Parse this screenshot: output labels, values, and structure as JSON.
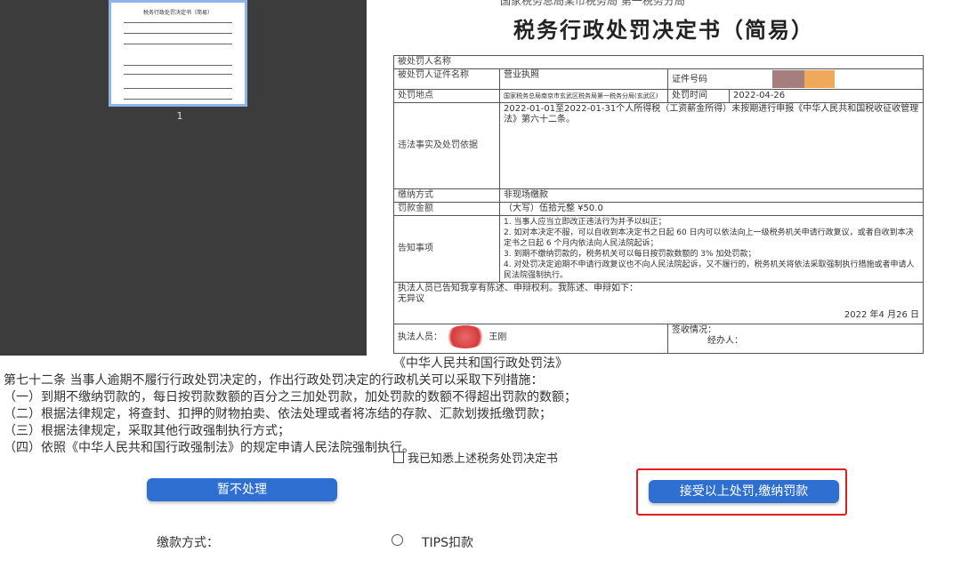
{
  "thumbnail": {
    "page_number": "1",
    "mini_title": "税务行政处罚决定书（简易）"
  },
  "document": {
    "top_text": "国家税务总局某市税务局  第一税务分局",
    "title": "税务行政处罚决定书（简易）",
    "rows": {
      "party_name_label": "被处罚人名称",
      "party_id_label": "被处罚人证件名称",
      "party_id_value": "营业执照",
      "cert_no_label": "证件号码",
      "location_label": "处罚地点",
      "location_value": "国家税务总局南京市玄武区税务局第一税务分局(玄武区)",
      "time_label": "处罚时间",
      "time_value": "2022-04-26",
      "facts_label": "违法事实及处罚依据",
      "facts_value": "2022-01-01至2022-01-31个人所得税（工资薪金所得）未按期进行申报《中华人民共和国税收征收管理法》第六十二条。",
      "payment_method_label": "缴纳方式",
      "payment_method_value": "非现场缴款",
      "fine_label": "罚款金额",
      "fine_value": "（大写）伍拾元整 ¥50.0",
      "notice_label": "告知事项",
      "notice_lines": [
        "1. 当事人应当立即改正违法行为并予以纠正；",
        "2. 如对本决定不服，可以自收到本决定书之日起 60 日内可以依法向上一级税务机关申请行政复议，或者自收到本决定书之日起 6 个月内依法向人民法院起诉；",
        "3. 到期不缴纳罚款的，税务机关可以每日按罚款数额的 3% 加处罚款；",
        "4. 对处罚决定逾期不申请行政复议也不向人民法院起诉，又不履行的，税务机关将依法采取强制执行措施或者申请人民法院强制执行。"
      ],
      "statement": "执法人员已告知我享有陈述、申辩权利。我陈述、申辩如下：",
      "statement_value": "无异议",
      "date_text": "2022 年4 月26 日",
      "receipt_label": "签收情况：",
      "officer_label": "执法人员：",
      "officer_name": "王刚",
      "handler_label": "经办人："
    }
  },
  "law": {
    "title": "《中华人民共和国行政处罚法》",
    "lines": [
      "第七十二条  当事人逾期不履行行政处罚决定的，作出行政处罚决定的行政机关可以采取下列措施：",
      "（一）到期不缴纳罚款的，每日按罚款数额的百分之三加处罚款，加处罚款的数额不得超出罚款的数额；",
      "（二）根据法律规定，将查封、扣押的财物拍卖、依法处理或者将冻结的存款、汇款划拨抵缴罚款；",
      "（三）根据法律规定，采取其他行政强制执行方式；",
      "（四）依照《中华人民共和国行政强制法》的规定申请人民法院强制执行。"
    ]
  },
  "consent_label": "我已知悉上述税务处罚决定书",
  "buttons": {
    "decline": "暂不处理",
    "accept": "接受以上处罚,缴纳罚款"
  },
  "payment": {
    "label": "缴款方式：",
    "option": "TIPS扣款"
  },
  "colors": {
    "primary": "#2f6fd2",
    "highlight": "#e02020"
  }
}
